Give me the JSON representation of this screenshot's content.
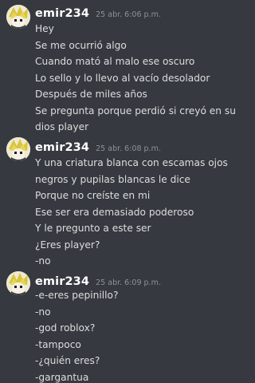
{
  "messages": [
    {
      "username": "emir234",
      "timestamp": "25 abr. 6:06 p.m.",
      "lines": [
        "Hey",
        "Se me ocurrió algo",
        "Cuando mató al malo ese oscuro",
        "Lo sello y lo llevo al vacío desolador",
        "Después de miles años",
        "Se pregunta porque perdió si creyó en su dios player"
      ]
    },
    {
      "username": "emir234",
      "timestamp": "25 abr. 6:08 p.m.",
      "lines": [
        "Y una criatura blanca con escamas ojos negros y pupilas blancas le dice",
        "Porque no creíste en mi",
        "Ese ser era demasiado poderoso",
        "Y le pregunto a este ser",
        "¿Eres player?",
        "-no"
      ]
    },
    {
      "username": "emir234",
      "timestamp": "25 abr. 6:09 p.m.",
      "lines": [
        "-e-eres pepinillo?",
        "-no",
        "-god roblox?",
        "-tampoco",
        "-¿quién eres?",
        "-gargantua"
      ]
    }
  ]
}
